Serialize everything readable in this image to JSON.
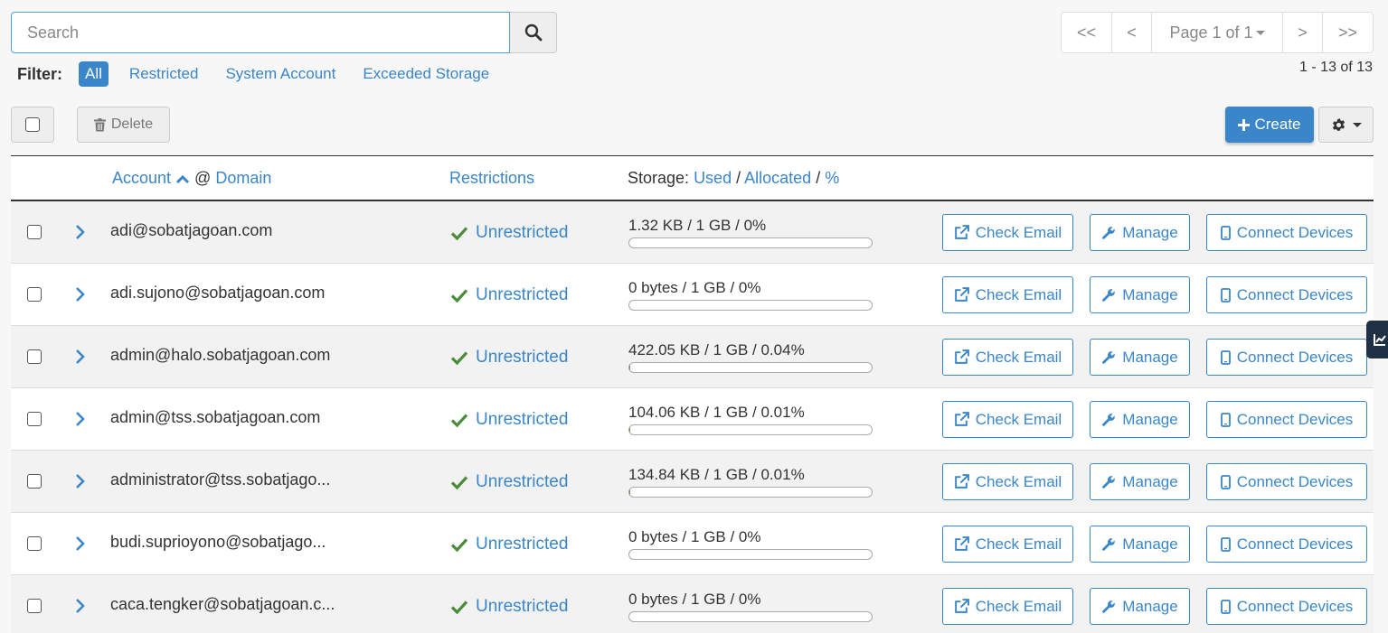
{
  "search": {
    "placeholder": "Search"
  },
  "filter": {
    "label": "Filter:",
    "items": [
      "All",
      "Restricted",
      "System Account",
      "Exceeded Storage"
    ],
    "active": "All"
  },
  "pager": {
    "first": "<<",
    "prev": "<",
    "page_label": "Page 1 of 1",
    "next": ">",
    "last": ">>",
    "range": "1 - 13 of 13"
  },
  "toolbar": {
    "delete_label": "Delete",
    "create_label": "Create"
  },
  "table": {
    "col_account": "Account",
    "col_at": "@",
    "col_domain": "Domain",
    "col_restrictions": "Restrictions",
    "col_storage_prefix": "Storage:",
    "col_used": "Used",
    "col_sep1": "/",
    "col_allocated": "Allocated",
    "col_sep2": "/",
    "col_pct": "%",
    "action_check": "Check Email",
    "action_manage": "Manage",
    "action_connect": "Connect Devices",
    "rows": [
      {
        "email": "adi@sobatjagoan.com",
        "restriction": "Unrestricted",
        "storage": "1.32 KB / 1 GB / 0%",
        "usage_pct": 0
      },
      {
        "email": "adi.sujono@sobatjagoan.com",
        "restriction": "Unrestricted",
        "storage": "0 bytes / 1 GB / 0%",
        "usage_pct": 0
      },
      {
        "email": "admin@halo.sobatjagoan.com",
        "restriction": "Unrestricted",
        "storage": "422.05 KB / 1 GB / 0.04%",
        "usage_pct": 0.04
      },
      {
        "email": "admin@tss.sobatjagoan.com",
        "restriction": "Unrestricted",
        "storage": "104.06 KB / 1 GB / 0.01%",
        "usage_pct": 0.01
      },
      {
        "email": "administrator@tss.sobatjago...",
        "restriction": "Unrestricted",
        "storage": "134.84 KB / 1 GB / 0.01%",
        "usage_pct": 0.01
      },
      {
        "email": "budi.suprioyono@sobatjago...",
        "restriction": "Unrestricted",
        "storage": "0 bytes / 1 GB / 0%",
        "usage_pct": 0
      },
      {
        "email": "caca.tengker@sobatjagoan.c...",
        "restriction": "Unrestricted",
        "storage": "0 bytes / 1 GB / 0%",
        "usage_pct": 0
      }
    ]
  },
  "colors": {
    "accent": "#3a86c8",
    "success": "#4a8c3a",
    "sidebar_tab": "#1f2f44"
  }
}
